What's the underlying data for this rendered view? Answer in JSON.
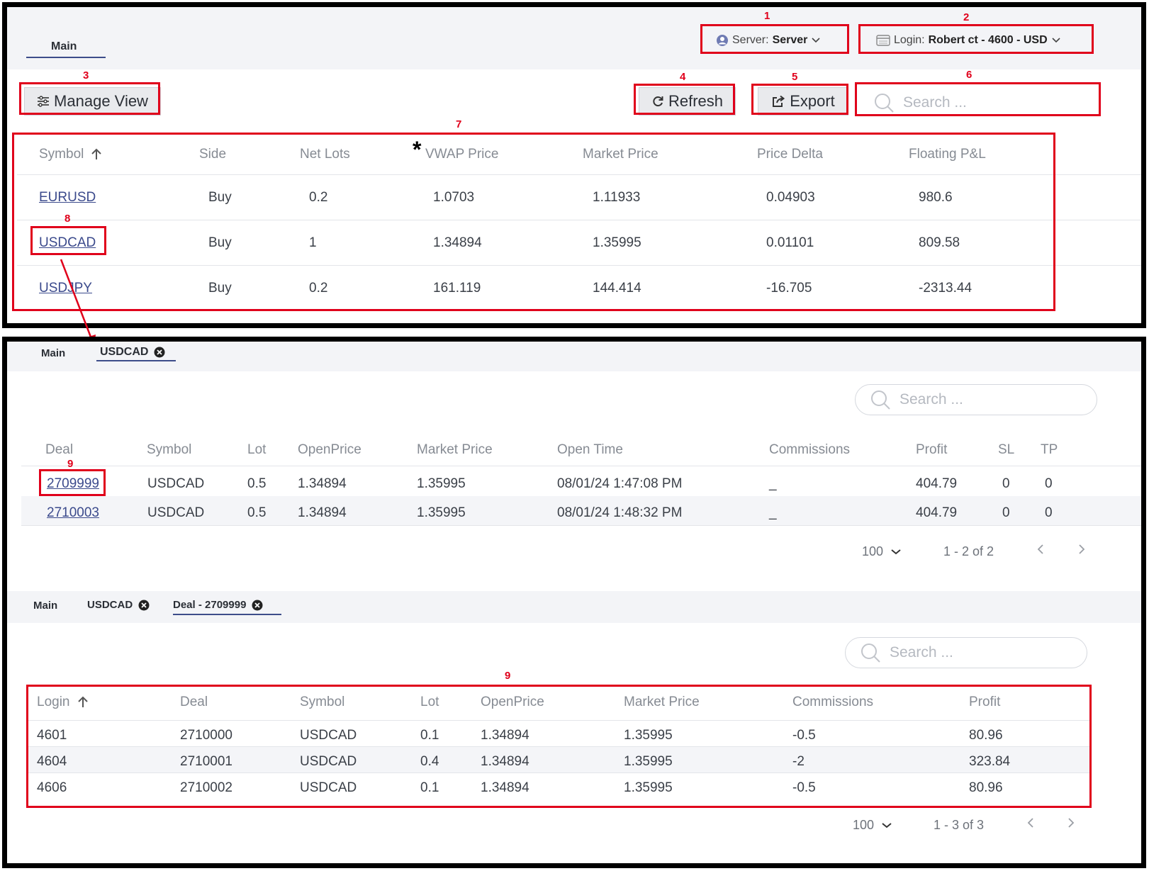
{
  "annotations": [
    "1",
    "2",
    "3",
    "4",
    "5",
    "6",
    "7",
    "8",
    "9",
    "9"
  ],
  "top": {
    "tab_main": "Main",
    "server_prefix": "Server:",
    "server_value": "Server",
    "login_prefix": "Login:",
    "login_value": "Robert ct - 4600 - USD",
    "manage_view": "Manage View",
    "refresh": "Refresh",
    "export": "Export",
    "search_placeholder": "Search ...",
    "asterisk": "*",
    "columns": [
      "Symbol",
      "Side",
      "Net Lots",
      "VWAP Price",
      "Market Price",
      "Price Delta",
      "Floating P&L"
    ],
    "rows": [
      [
        "EURUSD",
        "Buy",
        "0.2",
        "1.0703",
        "1.11933",
        "0.04903",
        "980.6"
      ],
      [
        "USDCAD",
        "Buy",
        "1",
        "1.34894",
        "1.35995",
        "0.01101",
        "809.58"
      ],
      [
        "USDJPY",
        "Buy",
        "0.2",
        "161.119",
        "144.414",
        "-16.705",
        "-2313.44"
      ]
    ]
  },
  "middle": {
    "tab_main": "Main",
    "tab_usdcad": "USDCAD",
    "search_placeholder": "Search ...",
    "columns": [
      "Deal",
      "Symbol",
      "Lot",
      "OpenPrice",
      "Market Price",
      "Open Time",
      "Commissions",
      "Profit",
      "SL",
      "TP"
    ],
    "rows": [
      [
        "2709999",
        "USDCAD",
        "0.5",
        "1.34894",
        "1.35995",
        "08/01/24 1:47:08 PM",
        "_",
        "404.79",
        "0",
        "0"
      ],
      [
        "2710003",
        "USDCAD",
        "0.5",
        "1.34894",
        "1.35995",
        "08/01/24 1:48:32 PM",
        "_",
        "404.79",
        "0",
        "0"
      ]
    ],
    "page_size": "100",
    "page_range": "1 - 2 of 2"
  },
  "bottom": {
    "tab_main": "Main",
    "tab_usdcad": "USDCAD",
    "tab_deal": "Deal - 2709999",
    "search_placeholder": "Search ...",
    "columns": [
      "Login",
      "Deal",
      "Symbol",
      "Lot",
      "OpenPrice",
      "Market Price",
      "Commissions",
      "Profit"
    ],
    "rows": [
      [
        "4601",
        "2710000",
        "USDCAD",
        "0.1",
        "1.34894",
        "1.35995",
        "-0.5",
        "80.96"
      ],
      [
        "4604",
        "2710001",
        "USDCAD",
        "0.4",
        "1.34894",
        "1.35995",
        "-2",
        "323.84"
      ],
      [
        "4606",
        "2710002",
        "USDCAD",
        "0.1",
        "1.34894",
        "1.35995",
        "-0.5",
        "80.96"
      ]
    ],
    "page_size": "100",
    "page_range": "1 - 3 of 3"
  },
  "colors": {
    "annotation_red": "#e0001b",
    "link_blue": "#3b4a8c",
    "tab_underline": "#3d4d8a"
  },
  "icons": [
    "user-circle-icon",
    "login-card-icon",
    "chevron-down-icon",
    "sliders-icon",
    "refresh-icon",
    "export-icon",
    "search-icon",
    "sort-up-arrow-icon",
    "close-circle-icon",
    "chevron-left-icon",
    "chevron-right-icon"
  ]
}
